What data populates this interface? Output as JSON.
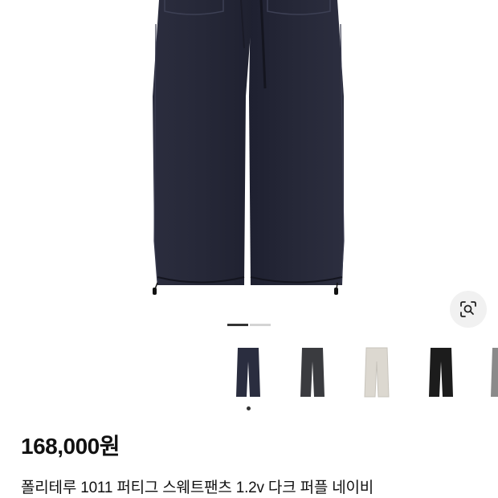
{
  "product": {
    "price": "168,000원",
    "title": "폴리테루 1011 퍼티그 스웨트팬츠 1.2v 다크 퍼플 네이비"
  },
  "gallery": {
    "total_images": 2,
    "active_index": 0
  },
  "thumbnails": [
    {
      "color": "#2a2d3f",
      "selected": true
    },
    {
      "color": "#3a3b3f",
      "selected": false
    },
    {
      "color": "#dcd8d0",
      "selected": false
    },
    {
      "color": "#1c1c1c",
      "selected": false
    },
    {
      "color": "#8a8a8a",
      "selected": false
    }
  ],
  "icons": {
    "image_search": "lens-search-icon"
  },
  "colors": {
    "pants_main": "#262838",
    "pants_shadow": "#1b1c28"
  }
}
